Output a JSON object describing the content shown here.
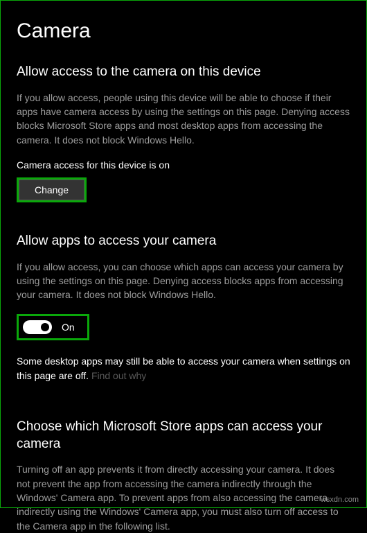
{
  "page": {
    "title": "Camera"
  },
  "section1": {
    "heading": "Allow access to the camera on this device",
    "body": "If you allow access, people using this device will be able to choose if their apps have camera access by using the settings on this page. Denying access blocks Microsoft Store apps and most desktop apps from accessing the camera. It does not block Windows Hello.",
    "status": "Camera access for this device is on",
    "change_label": "Change"
  },
  "section2": {
    "heading": "Allow apps to access your camera",
    "body": "If you allow access, you can choose which apps can access your camera by using the settings on this page. Denying access blocks apps from accessing your camera. It does not block Windows Hello.",
    "toggle_state": "On",
    "note": "Some desktop apps may still be able to access your camera when settings on this page are off. ",
    "note_link": "Find out why"
  },
  "section3": {
    "heading": "Choose which Microsoft Store apps can access your camera",
    "body": "Turning off an app prevents it from directly accessing your camera. It does not prevent the app from accessing the camera indirectly through the Windows' Camera app. To prevent apps from also accessing the camera indirectly using the Windows' Camera app, you must also turn off access to the Camera app in the following list."
  },
  "watermark": "wsxdn.com"
}
